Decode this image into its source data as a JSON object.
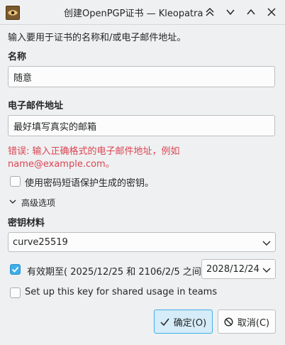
{
  "window": {
    "title": "创建OpenPGP证书 — Kleopatra"
  },
  "form": {
    "intro": "输入要用于证书的名称和/或电子邮件地址。",
    "name_label": "名称",
    "name_value": "随意",
    "email_label": "电子邮件地址",
    "email_value": "最好填写真实的邮箱",
    "error_line1": "错误: 输入正确格式的电子邮件地址，例如",
    "error_line2": "name@example.com。",
    "passphrase_label": "使用密码短语保护生成的密钥。",
    "passphrase_checked": false,
    "advanced_label": "高级选项",
    "key_material_label": "密钥材料",
    "key_material_value": "curve25519",
    "validity_label": "有效期至( 2025/12/25 和 2106/2/5 之间):",
    "validity_checked": true,
    "validity_date": "2028/12/24",
    "shared_label": "Set up this key for shared usage in teams",
    "shared_checked": false
  },
  "buttons": {
    "ok_label": "确定(O)",
    "cancel_label": "取消(C)"
  },
  "colors": {
    "accent": "#3daee9",
    "error": "#da4453",
    "background": "#eff0f1"
  },
  "icons": {
    "app": "kleopatra-icon",
    "keep_above": "keep-above-icon",
    "minimize": "minimize-icon",
    "maximize": "maximize-icon",
    "close": "close-icon",
    "ok": "checkmark-icon",
    "cancel": "cancel-circle-icon"
  }
}
